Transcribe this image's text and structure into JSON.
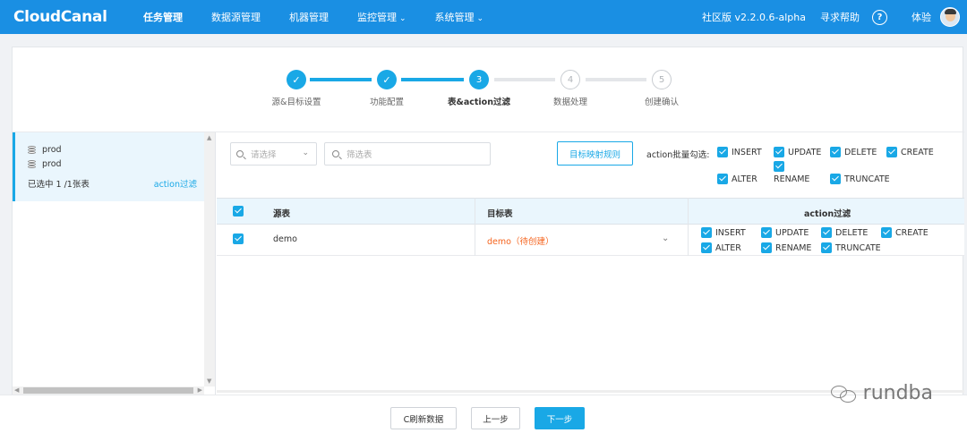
{
  "header": {
    "logo": "CloudCanal",
    "nav": [
      {
        "label": "任务管理",
        "active": true,
        "dropdown": false
      },
      {
        "label": "数据源管理",
        "active": false,
        "dropdown": false
      },
      {
        "label": "机器管理",
        "active": false,
        "dropdown": false
      },
      {
        "label": "监控管理",
        "active": false,
        "dropdown": true
      },
      {
        "label": "系统管理",
        "active": false,
        "dropdown": true
      }
    ],
    "version": "社区版 v2.2.0.6-alpha",
    "help": "寻求帮助",
    "help_icon_glyph": "?",
    "user": "体验",
    "chevron": "⌄"
  },
  "steps": {
    "done_glyph": "✓",
    "items": [
      {
        "num": "1",
        "label": "源&目标设置",
        "state": "done"
      },
      {
        "num": "2",
        "label": "功能配置",
        "state": "done"
      },
      {
        "num": "3",
        "label": "表&action过滤",
        "state": "current"
      },
      {
        "num": "4",
        "label": "数据处理",
        "state": "todo"
      },
      {
        "num": "5",
        "label": "创建确认",
        "state": "todo"
      }
    ]
  },
  "left_panel": {
    "source_db": "prod",
    "target_db": "prod",
    "selected_text": "已选中 1 /1张表",
    "action_link": "action过滤"
  },
  "filters": {
    "select_placeholder": "请选择",
    "table_filter_placeholder": "筛选表",
    "mapping_button": "目标映射规则",
    "batch_label": "action批量勾选:",
    "batch_actions": [
      "INSERT",
      "UPDATE",
      "DELETE",
      "CREATE",
      "ALTER",
      "RENAME",
      "TRUNCATE"
    ]
  },
  "table": {
    "headers": {
      "source": "源表",
      "target": "目标表",
      "action": "action过滤"
    },
    "rows": [
      {
        "checked": true,
        "source": "demo",
        "target": "demo（待创建）",
        "actions": [
          "INSERT",
          "UPDATE",
          "DELETE",
          "CREATE",
          "ALTER",
          "RENAME",
          "TRUNCATE"
        ]
      }
    ]
  },
  "footer": {
    "refresh": "C刷新数据",
    "prev": "上一步",
    "next": "下一步"
  },
  "watermark": "rundba",
  "colors": {
    "topbar": "#1a8fe3",
    "accent": "#19a8e6",
    "pending_target": "#f5641e"
  }
}
